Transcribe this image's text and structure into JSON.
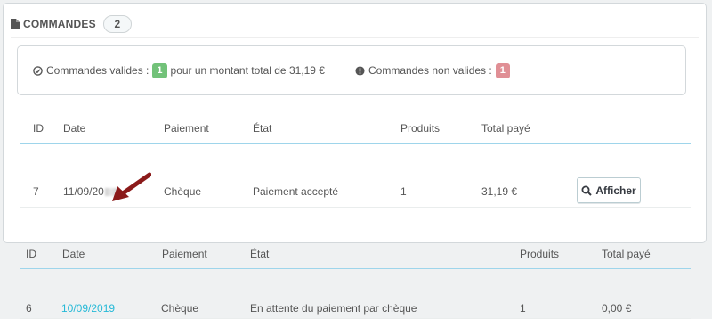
{
  "header": {
    "title": "COMMANDES",
    "count": "2",
    "icon": "document-icon"
  },
  "summary": {
    "valid_label": "Commandes valides :",
    "valid_count": "1",
    "valid_suffix": "pour un montant total de 31,19 €",
    "invalid_label": "Commandes non valides :",
    "invalid_count": "1",
    "colors": {
      "green": "#72c279",
      "red": "#e08f95"
    }
  },
  "table1": {
    "headers": [
      "ID",
      "Date",
      "Paiement",
      "État",
      "Produits",
      "Total payé"
    ],
    "row": {
      "id": "7",
      "date": "11/09/20",
      "payment": "Chèque",
      "state": "Paiement accepté",
      "products": "1",
      "total": "31,19 €",
      "button": "Afficher"
    }
  },
  "table2": {
    "headers": [
      "ID",
      "Date",
      "Paiement",
      "État",
      "Produits",
      "Total payé"
    ],
    "row": {
      "id": "6",
      "date": "10/09/2019",
      "payment": "Chèque",
      "state": "En attente du paiement par chèque",
      "products": "1",
      "total": "0,00 €"
    }
  },
  "annotation": {
    "arrow_color": "#8b1a1a"
  }
}
